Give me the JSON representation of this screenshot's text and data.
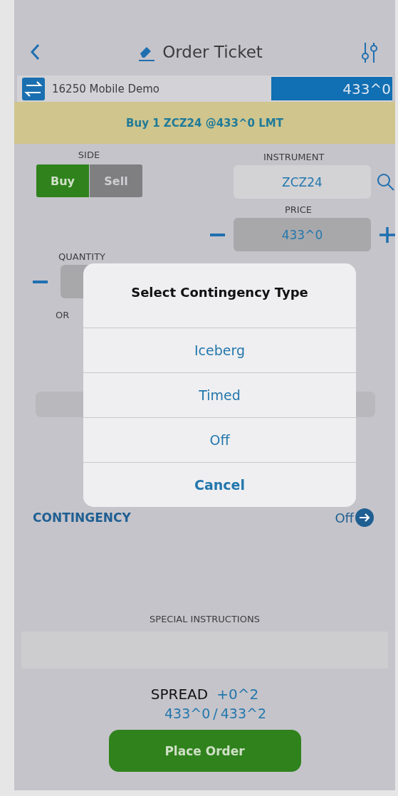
{
  "header": {
    "title": "Order Ticket"
  },
  "account": {
    "name": "16250 Mobile Demo",
    "last_price": "433^0"
  },
  "summary": "Buy 1 ZCZ24 @433^0 LMT",
  "side": {
    "label": "SIDE",
    "options": [
      {
        "label": "Buy",
        "selected": true
      },
      {
        "label": "Sell",
        "selected": false
      }
    ]
  },
  "instrument": {
    "label": "INSTRUMENT",
    "value": "ZCZ24"
  },
  "price": {
    "label": "PRICE",
    "value": "433^0"
  },
  "quantity": {
    "label": "QUANTITY"
  },
  "order_type": {
    "label": "OR"
  },
  "contingency": {
    "label": "CONTINGENCY",
    "value": "Off"
  },
  "special_instructions": {
    "label": "SPECIAL INSTRUCTIONS"
  },
  "spread": {
    "label": "SPREAD",
    "value": "+0^2",
    "bid": "433^0",
    "separator": "/",
    "ask": "433^2"
  },
  "place_order": "Place Order",
  "dialog": {
    "title": "Select Contingency Type",
    "options": [
      {
        "label": "Iceberg",
        "kind": "option"
      },
      {
        "label": "Timed",
        "kind": "option"
      },
      {
        "label": "Off",
        "kind": "option"
      },
      {
        "label": "Cancel",
        "kind": "cancel"
      }
    ]
  }
}
